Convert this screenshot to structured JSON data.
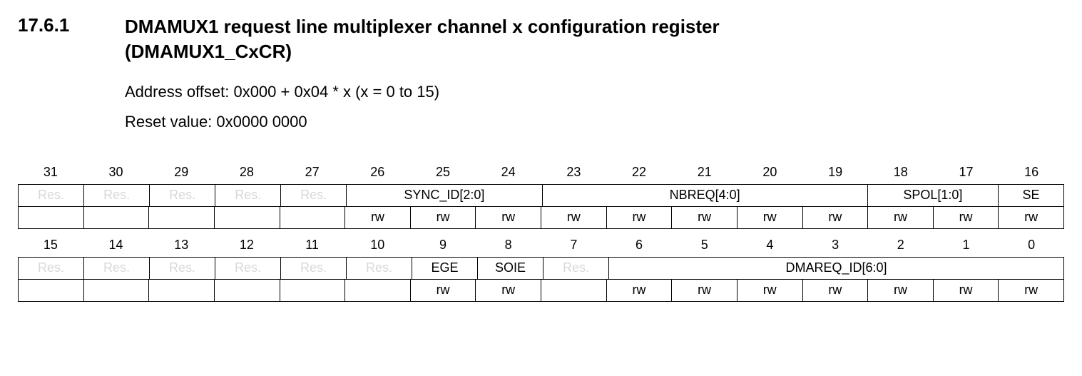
{
  "heading": {
    "number": "17.6.1",
    "title_line1": "DMAMUX1 request line multiplexer channel x configuration register",
    "title_line2": "(DMAMUX1_CxCR)"
  },
  "meta": {
    "address_offset": "Address offset: 0x000 + 0x04 * x (x = 0 to 15)",
    "reset_value": "Reset value: 0x0000 0000"
  },
  "labels": {
    "res": "Res.",
    "rw": "rw"
  },
  "bits_high": [
    "31",
    "30",
    "29",
    "28",
    "27",
    "26",
    "25",
    "24",
    "23",
    "22",
    "21",
    "20",
    "19",
    "18",
    "17",
    "16"
  ],
  "bits_low": [
    "15",
    "14",
    "13",
    "12",
    "11",
    "10",
    "9",
    "8",
    "7",
    "6",
    "5",
    "4",
    "3",
    "2",
    "1",
    "0"
  ],
  "fields_high": {
    "sync_id": "SYNC_ID[2:0]",
    "nbreq": "NBREQ[4:0]",
    "spol": "SPOL[1:0]",
    "se": "SE"
  },
  "fields_low": {
    "ege": "EGE",
    "soie": "SOIE",
    "dmareq_id": "DMAREQ_ID[6:0]"
  }
}
